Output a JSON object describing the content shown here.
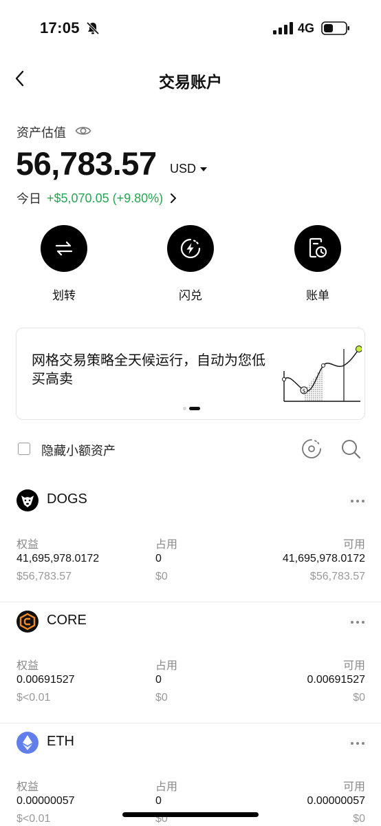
{
  "status": {
    "time": "17:05",
    "network": "4G"
  },
  "header": {
    "title": "交易账户"
  },
  "assets": {
    "label": "资产估值",
    "value": "56,783.57",
    "currency": "USD",
    "today_label": "今日",
    "today_change": "+$5,070.05 (+9.80%)"
  },
  "actions": [
    {
      "label": "划转",
      "icon": "transfer-icon"
    },
    {
      "label": "闪兑",
      "icon": "flash-convert-icon"
    },
    {
      "label": "账单",
      "icon": "bill-icon"
    }
  ],
  "banner": {
    "text": "网格交易策略全天候运行，自动为您低买高卖",
    "active_page": 2,
    "page_count": 2
  },
  "filter": {
    "hide_small_label": "隐藏小额资产",
    "checked": false
  },
  "columns": {
    "equity": "权益",
    "occupied": "占用",
    "available": "可用"
  },
  "coins": [
    {
      "name": "DOGS",
      "equity": "41,695,978.0172",
      "equity_usd": "$56,783.57",
      "occupied": "0",
      "occupied_usd": "$0",
      "available": "41,695,978.0172",
      "available_usd": "$56,783.57",
      "color": "#000000"
    },
    {
      "name": "CORE",
      "equity": "0.00691527",
      "equity_usd": "$<0.01",
      "occupied": "0",
      "occupied_usd": "$0",
      "available": "0.00691527",
      "available_usd": "$0",
      "color": "#f08a24"
    },
    {
      "name": "ETH",
      "equity": "0.00000057",
      "equity_usd": "$<0.01",
      "occupied": "0",
      "occupied_usd": "$0",
      "available": "0.00000057",
      "available_usd": "$0",
      "color": "#627eea"
    }
  ],
  "colors": {
    "positive": "#25a750",
    "accent": "#000000"
  }
}
